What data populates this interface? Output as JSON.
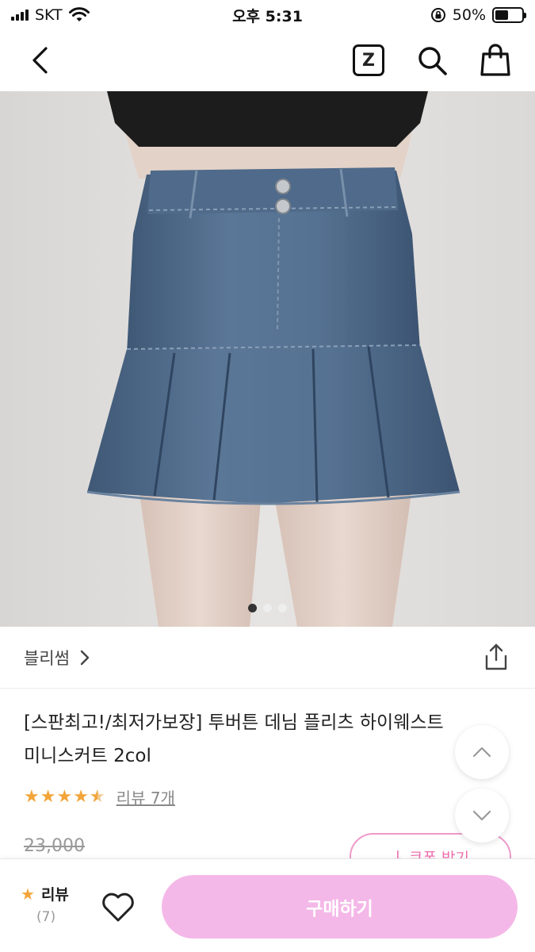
{
  "status_bar": {
    "carrier": "SKT",
    "time": "오후 5:31",
    "battery": "50%",
    "battery_level": 0.5
  },
  "nav": {
    "z_label": "Z"
  },
  "product_image": {
    "dot_count": 3,
    "active_dot": 0
  },
  "shop": {
    "name": "블리썸"
  },
  "product": {
    "title_line1": "[스판최고!/최저가보장] 투버튼 데님 플리츠 하이웨스트",
    "title_line2": "미니스커트 2col",
    "rating": 4.5,
    "review_link": "리뷰 7개",
    "old_price": "23,000",
    "coupon_label": "쿠폰 받기"
  },
  "bottom": {
    "review_label": "리뷰",
    "review_count": "(7)",
    "buy_label": "구매하기"
  },
  "colors": {
    "accent_pink": "#f4b8e8",
    "star": "#f2a53a",
    "denim": "#4d6a8c"
  }
}
